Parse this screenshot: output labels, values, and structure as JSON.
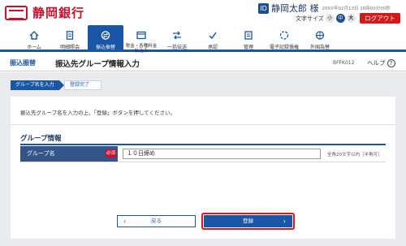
{
  "header": {
    "logo_text": "静岡銀行",
    "user_icon": "ID",
    "user_name": "静岡太郎 様",
    "last_login": "20XX年02月13日 16時00分00秒",
    "font_size_label": "文字サイズ",
    "font_sizes": [
      "小",
      "中",
      "大"
    ],
    "logout_label": "ログアウト"
  },
  "nav": {
    "items": [
      {
        "label": "ホーム",
        "icon": "home-icon"
      },
      {
        "label": "明細照会",
        "icon": "document-icon"
      },
      {
        "label": "振込振替",
        "icon": "transfer-icon"
      },
      {
        "label": "税金・各種料金\n払込み",
        "icon": "tax-payment-icon"
      },
      {
        "label": "一括伝送",
        "icon": "bulk-transfer-icon"
      },
      {
        "label": "承認",
        "icon": "approval-icon"
      },
      {
        "label": "管理",
        "icon": "admin-icon"
      },
      {
        "label": "電子記録債権",
        "icon": "e-bond-icon"
      },
      {
        "label": "外国為替",
        "icon": "forex-icon"
      }
    ],
    "active_index": 2
  },
  "titlebar": {
    "section": "振込振替",
    "title": "振込先グループ情報入力",
    "code": "BFFK012",
    "help_label": "ヘルプ",
    "help_icon": "?"
  },
  "steps": [
    "グループ名を入力",
    "登録完了"
  ],
  "form": {
    "instruction": "振込先グループ名を入力の上、「登録」ボタンを押してください。",
    "section_title": "グループ情報",
    "group_name_label": "グループ名",
    "required_badge": "必須",
    "group_name_value": "１０日締め",
    "hint": "全角20文字以内［半角可］"
  },
  "buttons": {
    "back_label": "戻る",
    "register_label": "登録"
  },
  "colors": {
    "brand_red": "#c8102e",
    "primary_blue": "#1a56a8",
    "highlight_red": "#e0141d"
  }
}
